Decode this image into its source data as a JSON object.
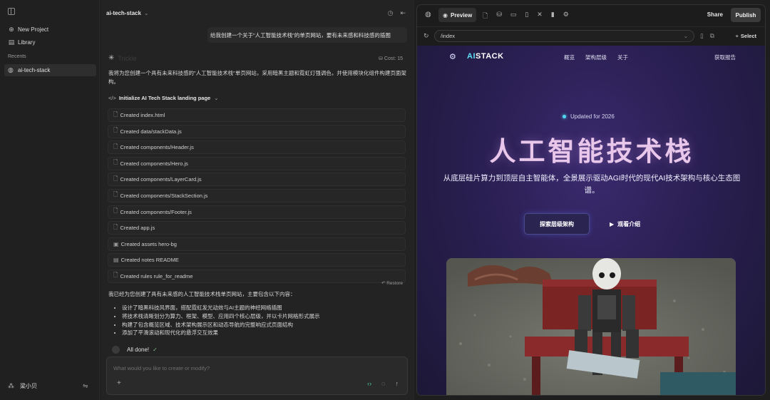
{
  "sidebar": {
    "toggle_icon": "sidebar-toggle-icon",
    "items": [
      {
        "icon": "plus-circle-icon",
        "label": "New Project"
      },
      {
        "icon": "library-icon",
        "label": "Library"
      }
    ],
    "recents_label": "Recents",
    "recent_project": "ai-tech-stack",
    "user_name": "梁小贝"
  },
  "chat": {
    "project_title": "ai-tech-stack",
    "user_message": "给我创建一个关于\"人工智能技术栈\"的单页网站，要有未来感和科技感的插图",
    "ai_name": "Trickle",
    "cost_label": "Cost: 15",
    "intro": "我将为您创建一个具有未来科技感的\"人工智能技术栈\"单页网站，采用暗黑主题和霓虹灯强调色，并使用模块化组件构建页面架构。",
    "init_label": "Initialize AI Tech Stack landing page",
    "files": [
      "Created index.html",
      "Created data/stackData.js",
      "Created components/Header.js",
      "Created components/Hero.js",
      "Created components/LayerCard.js",
      "Created components/StackSection.js",
      "Created components/Footer.js",
      "Created app.js",
      "Created assets hero-bg",
      "Created notes README",
      "Created rules rule_for_readme"
    ],
    "restore_label": "Restore",
    "summary": "我已经为您创建了具有未来感的人工智能技术栈单页网站，主要包含以下内容：",
    "bullets": [
      "设计了暗黑科技风界面，搭配霓虹发光动效与AI主题的神经网络插图",
      "将技术栈清晰划分为算力、框架、模型、应用四个核心层级，并以卡片网格形式展示",
      "构建了包含概览区域、技术架构展示区和动态导航的完整响应式页面结构",
      "添加了平滑滚动和现代化的悬浮交互效果"
    ],
    "done_label": "All done!",
    "composer_placeholder": "What would you like to create or modify?"
  },
  "preview": {
    "tab_label": "Preview",
    "share_label": "Share",
    "publish_label": "Publish",
    "url": "/index",
    "select_label": "Select"
  },
  "site": {
    "brand_ai": "AI",
    "brand_rest": "STACK",
    "nav": [
      "概览",
      "架构层级",
      "关于"
    ],
    "nav_cta": "获取报告",
    "badge": "Updated for 2026",
    "title": "人工智能技术栈",
    "subtitle": "从底层硅片算力到顶层自主智能体，全景展示驱动AGI时代的现代AI技术架构与核心生态图谱。",
    "primary_button": "探索层级架构",
    "secondary_button": "观看介绍"
  },
  "colors": {
    "accent_cyan": "#5ee1f5",
    "title_pink": "#e9c7ea",
    "site_bg": "#2a1f52",
    "check_green": "#7ec27e"
  }
}
